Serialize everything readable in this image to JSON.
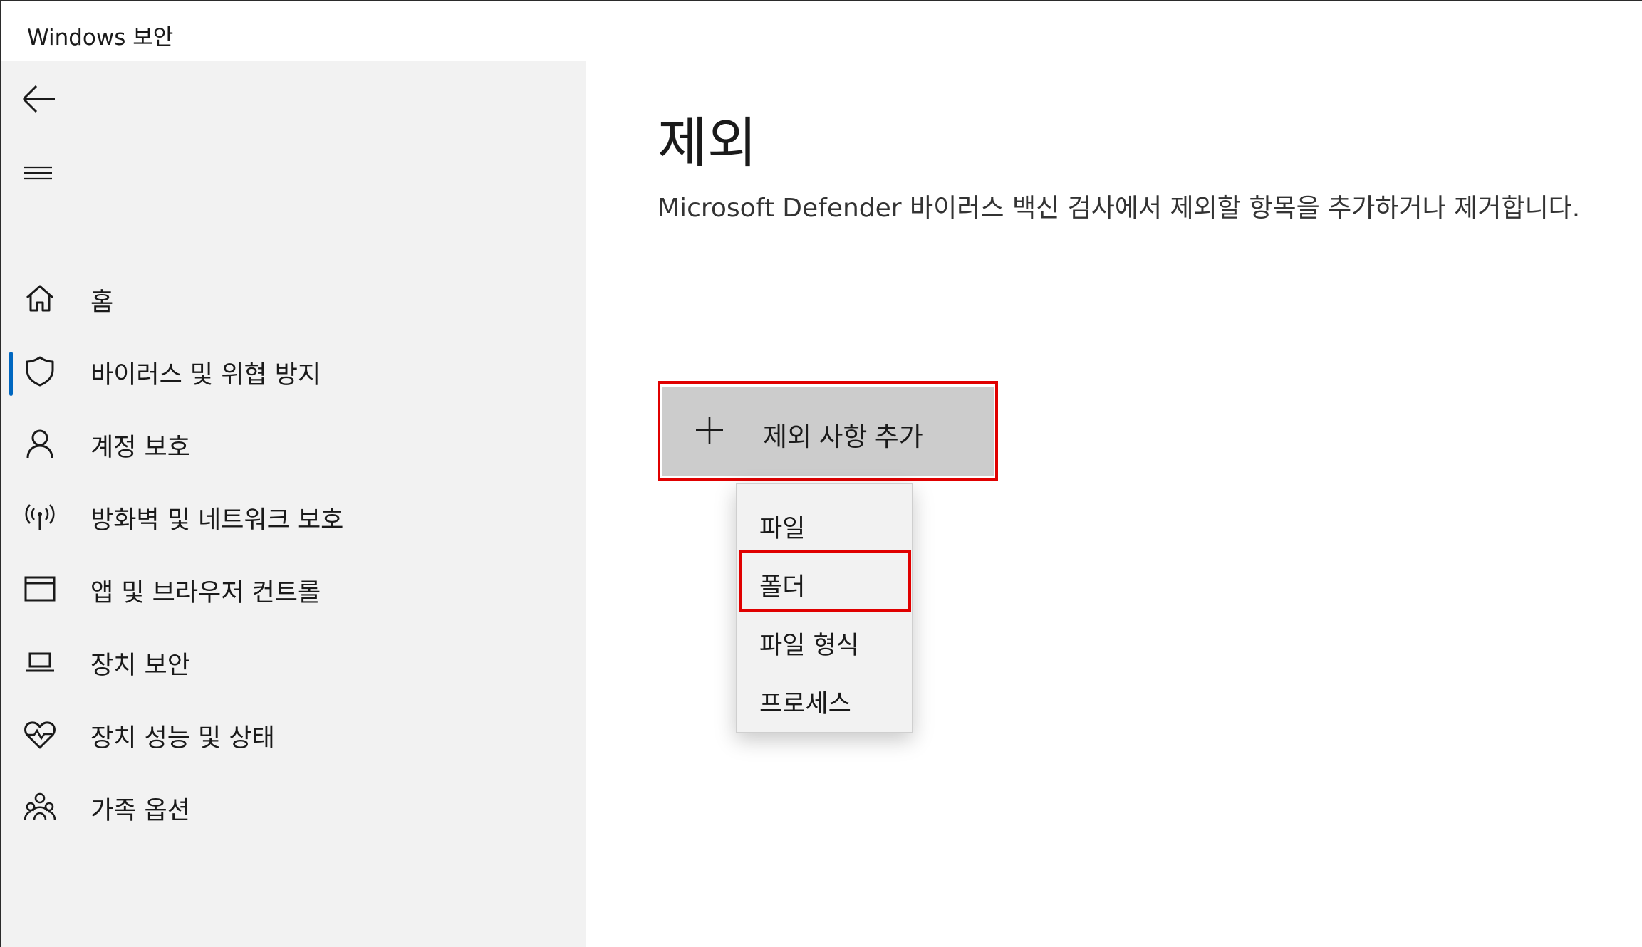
{
  "window": {
    "title": "Windows 보안"
  },
  "sidebar": {
    "back_icon": "back-arrow-icon",
    "menu_icon": "hamburger-icon",
    "accent_color": "#0067c0",
    "items": [
      {
        "label": "홈",
        "icon": "home-icon",
        "selected": false
      },
      {
        "label": "바이러스 및 위협 방지",
        "icon": "shield-icon",
        "selected": true
      },
      {
        "label": "계정 보호",
        "icon": "person-icon",
        "selected": false
      },
      {
        "label": "방화벽 및 네트워크 보호",
        "icon": "antenna-icon",
        "selected": false
      },
      {
        "label": "앱 및 브라우저 컨트롤",
        "icon": "browser-window-icon",
        "selected": false
      },
      {
        "label": "장치 보안",
        "icon": "laptop-icon",
        "selected": false
      },
      {
        "label": "장치 성능 및 상태",
        "icon": "heart-pulse-icon",
        "selected": false
      },
      {
        "label": "가족 옵션",
        "icon": "family-icon",
        "selected": false
      }
    ]
  },
  "main": {
    "title": "제외",
    "description": "Microsoft Defender 바이러스 백신 검사에서 제외할 항목을 추가하거나 제거합니다.",
    "add_button": {
      "label": "제외 사항 추가",
      "icon": "plus-icon"
    },
    "dropdown": {
      "items": [
        "파일",
        "폴더",
        "파일 형식",
        "프로세스"
      ],
      "highlighted": "폴더"
    },
    "highlight_color": "#e00000"
  }
}
